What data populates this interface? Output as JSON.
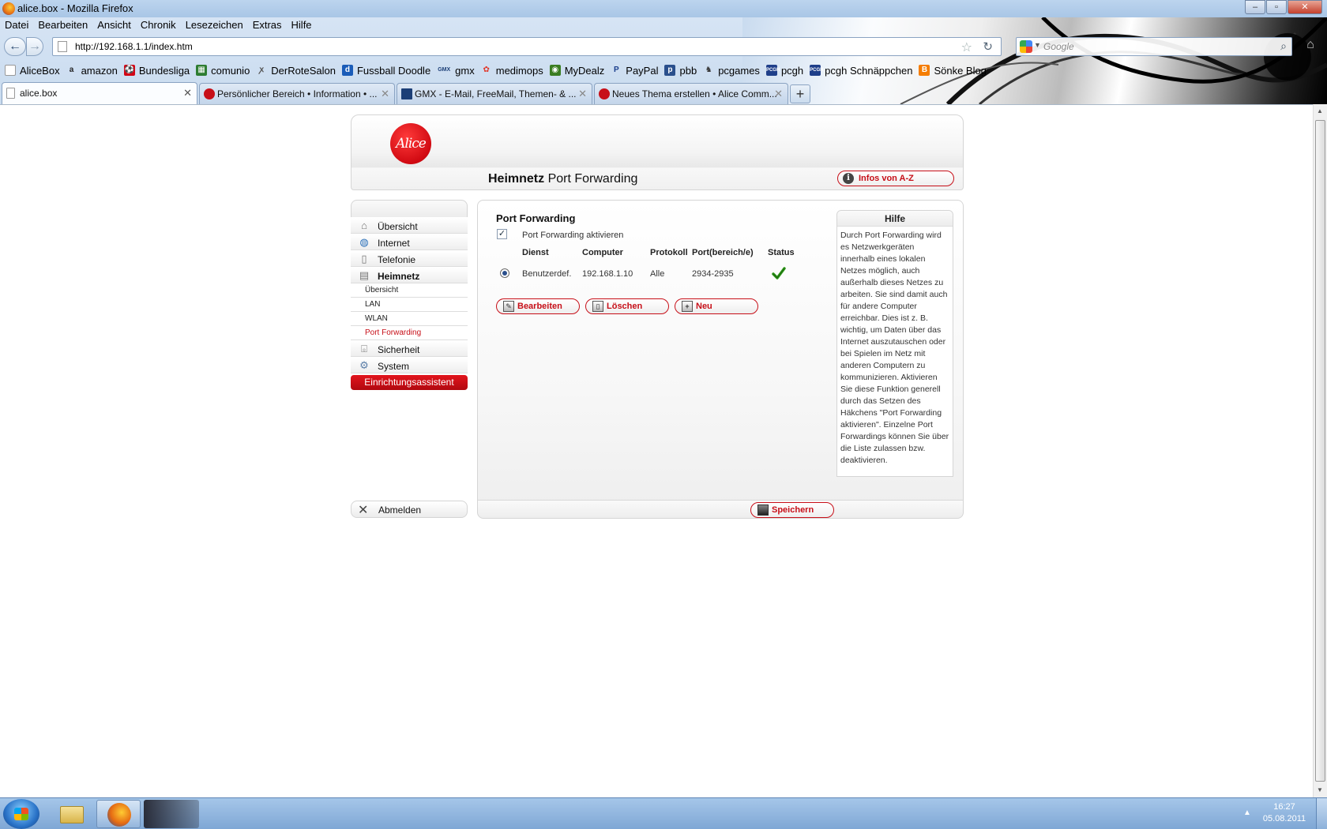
{
  "window": {
    "title": "alice.box - Mozilla Firefox",
    "controls": {
      "minimize": "–",
      "maximize": "▫",
      "close": "✕"
    }
  },
  "menubar": [
    "Datei",
    "Bearbeiten",
    "Ansicht",
    "Chronik",
    "Lesezeichen",
    "Extras",
    "Hilfe"
  ],
  "navbar": {
    "url": "http://192.168.1.1/index.htm",
    "search_placeholder": "Google",
    "back": "←",
    "forward": "→"
  },
  "bookmarks": [
    {
      "label": "AliceBox",
      "icon": "page-icon",
      "color": "#ffffff"
    },
    {
      "label": "amazon",
      "icon": "amazon-icon",
      "color": "#222222"
    },
    {
      "label": "Bundesliga",
      "icon": "bundesliga-icon",
      "color": "#d20515"
    },
    {
      "label": "comunio",
      "icon": "comunio-icon",
      "color": "#2e7d32"
    },
    {
      "label": "DerRoteSalon",
      "icon": "salon-icon",
      "color": "#555555"
    },
    {
      "label": "Fussball Doodle",
      "icon": "doodle-icon",
      "color": "#1a5cb8"
    },
    {
      "label": "gmx",
      "icon": "gmx-icon",
      "color": "#1c3f77"
    },
    {
      "label": "medimops",
      "icon": "medimops-icon",
      "color": "#e0382b"
    },
    {
      "label": "MyDealz",
      "icon": "mydealz-icon",
      "color": "#3a7d22"
    },
    {
      "label": "PayPal",
      "icon": "paypal-icon",
      "color": "#1a3e8c"
    },
    {
      "label": "pbb",
      "icon": "pbb-icon",
      "color": "#2a4f8c"
    },
    {
      "label": "pcgames",
      "icon": "pcgames-icon",
      "color": "#3a3a3a"
    },
    {
      "label": "pcgh",
      "icon": "pcgh-icon",
      "color": "#1f3f8a"
    },
    {
      "label": "pcgh Schnäppchen",
      "icon": "pcgh-icon",
      "color": "#1f3f8a"
    },
    {
      "label": "Sönke Blog",
      "icon": "blogger-icon",
      "color": "#f57d00"
    }
  ],
  "tabs": [
    {
      "label": "alice.box",
      "active": true,
      "close": "✕"
    },
    {
      "label": "Persönlicher Bereich • Information • ...",
      "active": false,
      "close": "✕"
    },
    {
      "label": "GMX - E-Mail, FreeMail, Themen- & ...",
      "active": false,
      "close": "✕"
    },
    {
      "label": "Neues Thema erstellen • Alice Comm...",
      "active": false,
      "close": "✕"
    }
  ],
  "newtab": "+",
  "alice": {
    "logo": "Alice",
    "heading_bold": "Heimnetz",
    "heading_rest": " Port Forwarding",
    "infos_button": "Infos von A-Z",
    "sidebar": {
      "items": [
        {
          "label": "Übersicht",
          "icon": "house-icon"
        },
        {
          "label": "Internet",
          "icon": "globe-icon"
        },
        {
          "label": "Telefonie",
          "icon": "phone-icon"
        },
        {
          "label": "Heimnetz",
          "icon": "network-icon"
        }
      ],
      "sub_items": [
        {
          "label": "Übersicht",
          "current": false
        },
        {
          "label": "LAN",
          "current": false
        },
        {
          "label": "WLAN",
          "current": false
        },
        {
          "label": "Port Forwarding",
          "current": true
        }
      ],
      "items_after": [
        {
          "label": "Sicherheit",
          "icon": "lock-icon"
        },
        {
          "label": "System",
          "icon": "gears-icon"
        }
      ],
      "assistant": "Einrichtungsassistent",
      "logout": "Abmelden"
    },
    "main": {
      "title": "Port Forwarding",
      "checkbox_label": "Port Forwarding aktivieren",
      "checkbox_checked": true,
      "columns": [
        "Dienst",
        "Computer",
        "Protokoll",
        "Port(bereich/e)",
        "Status"
      ],
      "rows": [
        {
          "selected": true,
          "dienst": "Benutzerdef.",
          "computer": "192.168.1.10",
          "protokoll": "Alle",
          "port": "2934-2935",
          "status": "active"
        }
      ],
      "buttons": {
        "edit": "Bearbeiten",
        "delete": "Löschen",
        "new": "Neu"
      },
      "save": "Speichern"
    },
    "help": {
      "title": "Hilfe",
      "text": "Durch Port Forwarding wird es Netzwerkgeräten innerhalb eines lokalen Netzes möglich, auch außerhalb dieses Netzes zu arbeiten. Sie sind damit auch für andere Computer erreichbar. Dies ist z. B. wichtig, um Daten über das Internet auszutauschen oder bei Spielen im Netz mit anderen Computern zu kommunizieren. Aktivieren Sie diese Funktion generell durch das Setzen des Häkchens \"Port Forwarding aktivieren\". Einzelne Port Forwardings können Sie über die Liste zulassen bzw. deaktivieren."
    },
    "colors": {
      "accent": "#c70f18",
      "link": "#c70f18"
    }
  },
  "taskbar": {
    "clock_time": "16:27",
    "clock_date": "05.08.2011",
    "tray_arrow": "▲"
  }
}
